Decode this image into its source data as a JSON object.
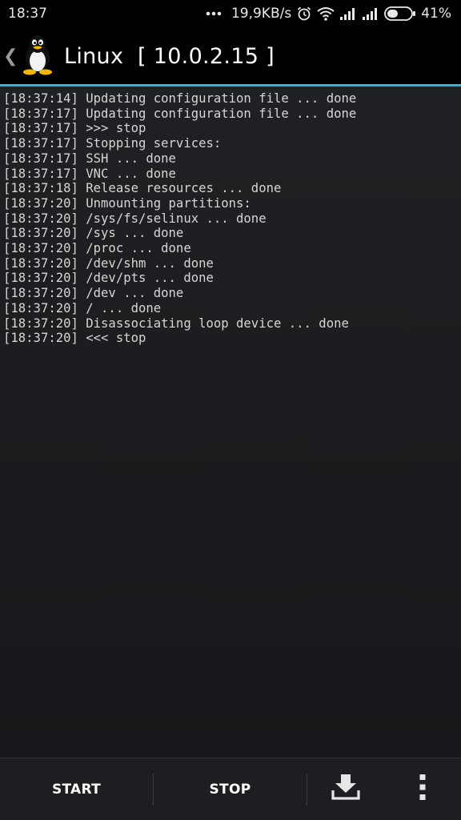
{
  "status_bar": {
    "time": "18:37",
    "network_speed": "19,9KB/s",
    "battery_percent": "41%",
    "icons": [
      "more-dots-icon",
      "alarm-clock-icon",
      "wifi-icon",
      "signal-icon",
      "signal-icon",
      "battery-icon"
    ]
  },
  "app_bar": {
    "title": "Linux  [ 10.0.2.15 ]",
    "app_icon": "tux-penguin-icon",
    "up_icon": "chevron-left-icon",
    "accent_color": "#33b5e5"
  },
  "console": {
    "lines": [
      "[18:37:14] Updating configuration file ... done",
      "[18:37:17] Updating configuration file ... done",
      "[18:37:17] >>> stop",
      "[18:37:17] Stopping services:",
      "[18:37:17] SSH ... done",
      "[18:37:17] VNC ... done",
      "[18:37:18] Release resources ... done",
      "[18:37:20] Unmounting partitions:",
      "[18:37:20] /sys/fs/selinux ... done",
      "[18:37:20] /sys ... done",
      "[18:37:20] /proc ... done",
      "[18:37:20] /dev/shm ... done",
      "[18:37:20] /dev/pts ... done",
      "[18:37:20] /dev ... done",
      "[18:37:20] / ... done",
      "[18:37:20] Disassociating loop device ... done",
      "[18:37:20] <<< stop"
    ]
  },
  "bottom_bar": {
    "start_label": "START",
    "stop_label": "STOP",
    "export_icon": "download-tray-icon",
    "overflow_icon": "overflow-menu-icon"
  }
}
